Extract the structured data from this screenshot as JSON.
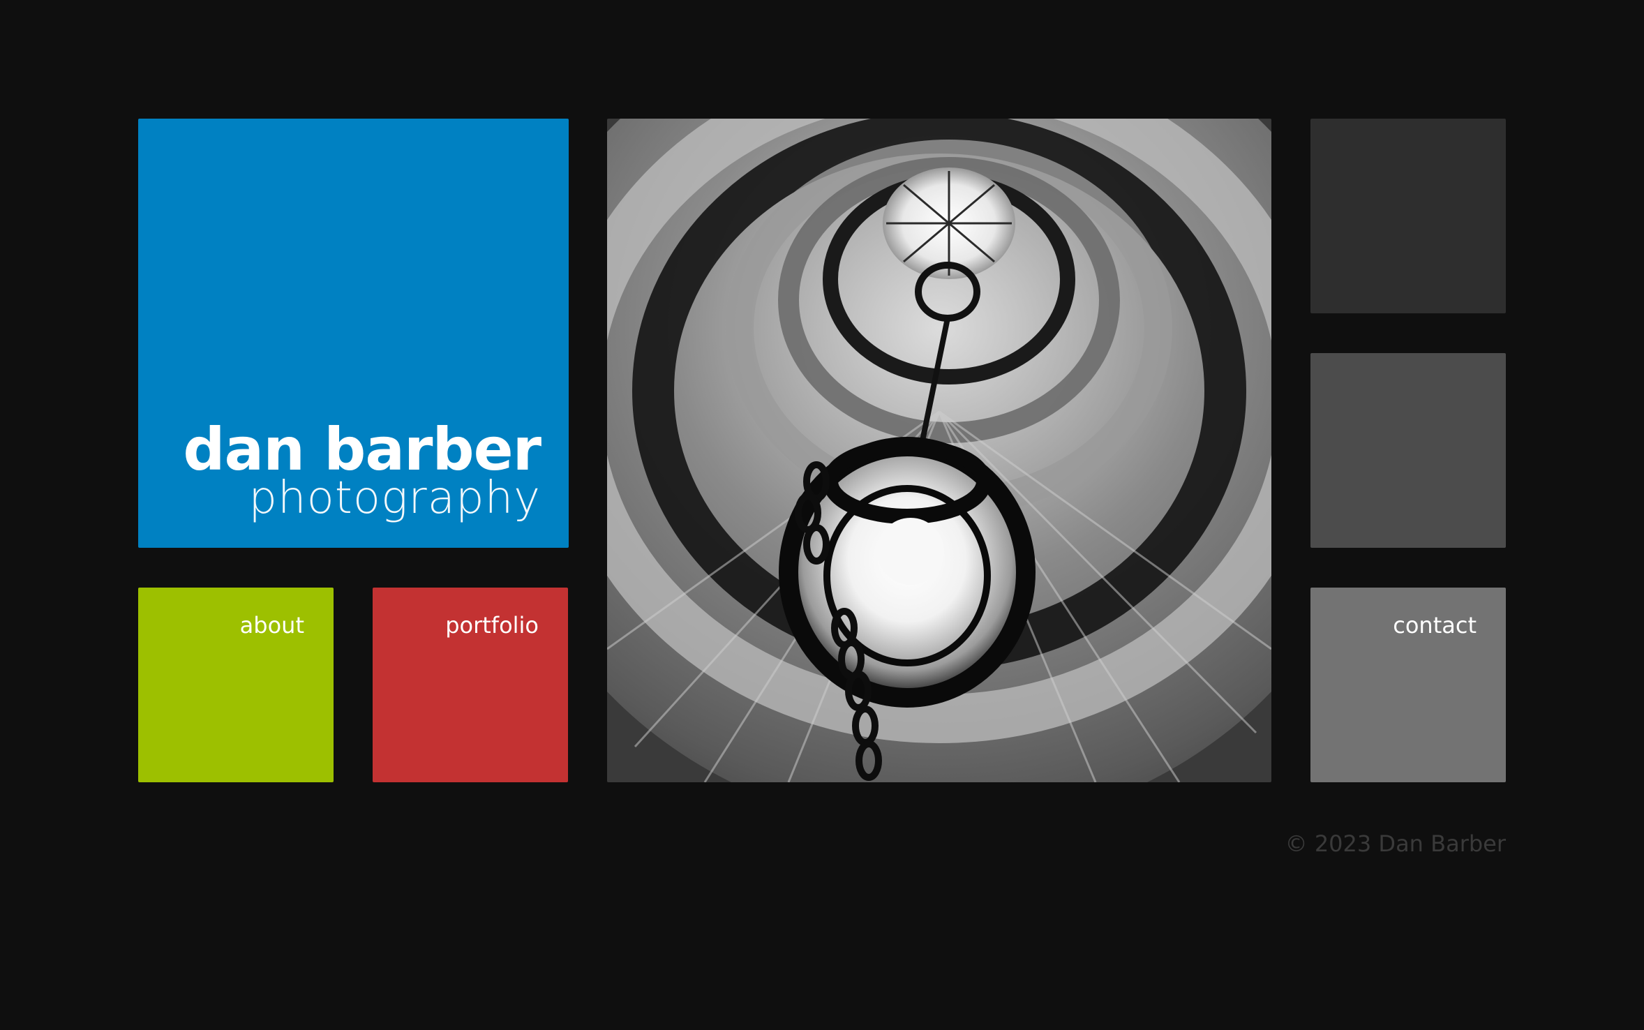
{
  "brand": {
    "name": "dan barber",
    "subtitle": "photography"
  },
  "nav": {
    "about": "about",
    "portfolio": "portfolio",
    "contact": "contact"
  },
  "colors": {
    "background": "#0f0f0f",
    "logo_tile": "#0081c2",
    "about_tile": "#9dc000",
    "portfolio_tile": "#c33232",
    "contact_tile": "#737373",
    "gray_tile_dark": "#2e2e2e",
    "gray_tile_mid": "#4c4c4c"
  },
  "footer": {
    "copyright": "© 2023 Dan Barber"
  }
}
